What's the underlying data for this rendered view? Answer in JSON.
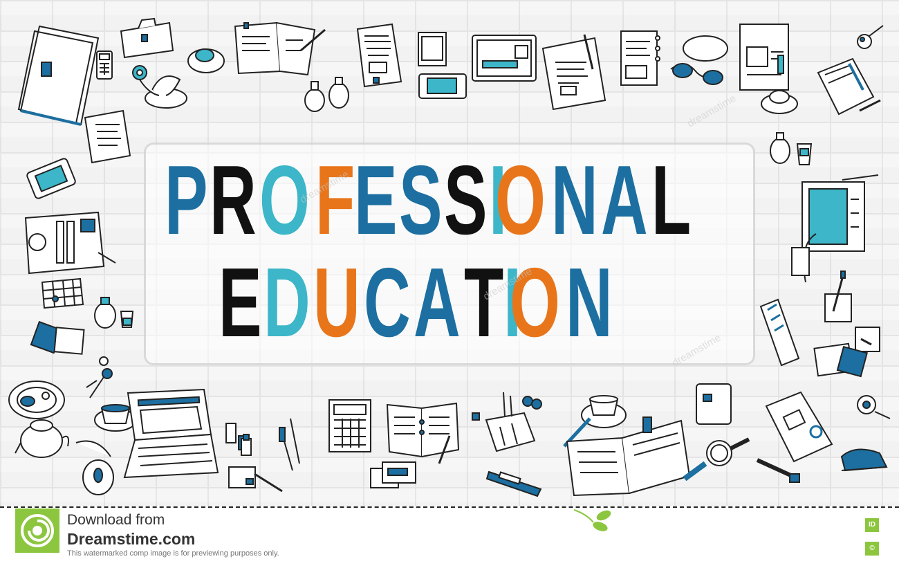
{
  "headline": {
    "line1": [
      {
        "ch": "P",
        "color": "#1c6fa0"
      },
      {
        "ch": "R",
        "color": "#111111"
      },
      {
        "ch": "O",
        "color": "#3cb6c8"
      },
      {
        "ch": "F",
        "color": "#e8751a"
      },
      {
        "ch": "E",
        "color": "#1c6fa0"
      },
      {
        "ch": "S",
        "color": "#1c6fa0"
      },
      {
        "ch": "S",
        "color": "#111111"
      },
      {
        "ch": "I",
        "color": "#3cb6c8"
      },
      {
        "ch": "O",
        "color": "#e8751a"
      },
      {
        "ch": "N",
        "color": "#1c6fa0"
      },
      {
        "ch": "A",
        "color": "#1c6fa0"
      },
      {
        "ch": "L",
        "color": "#111111"
      }
    ],
    "line2": [
      {
        "ch": "E",
        "color": "#111111"
      },
      {
        "ch": "D",
        "color": "#3cb6c8"
      },
      {
        "ch": "U",
        "color": "#e8751a"
      },
      {
        "ch": "C",
        "color": "#1c6fa0"
      },
      {
        "ch": "A",
        "color": "#1c6fa0"
      },
      {
        "ch": "T",
        "color": "#111111"
      },
      {
        "ch": "I",
        "color": "#3cb6c8"
      },
      {
        "ch": "O",
        "color": "#e8751a"
      },
      {
        "ch": "N",
        "color": "#1c6fa0"
      }
    ]
  },
  "colors": {
    "blue": "#1c6fa0",
    "cyan": "#3cb6c8",
    "orange": "#e8751a",
    "black": "#111111",
    "brand_green": "#8cc63f"
  },
  "doodles": [
    "folder-icon",
    "calculator-icon",
    "notebook-icon",
    "flower-pot-icon",
    "coffee-cup-icon",
    "document-icon",
    "smartphone-icon",
    "monitor-icon",
    "clipboard-icon",
    "glasses-icon",
    "tablet-icon",
    "laptop-icon",
    "mouse-icon",
    "keys-icon",
    "pen-icon",
    "scissors-icon",
    "stapler-icon",
    "watch-icon",
    "usb-icon",
    "cutter-icon",
    "open-book-icon",
    "calendar-icon"
  ],
  "watermark": {
    "text": "dreamstime"
  },
  "footer": {
    "download_label": "Download from",
    "site_name": "Dreamstime.com",
    "notice": "This watermarked comp image is for previewing purposes only.",
    "id_badge": "ID",
    "copyright_badge": "©"
  }
}
